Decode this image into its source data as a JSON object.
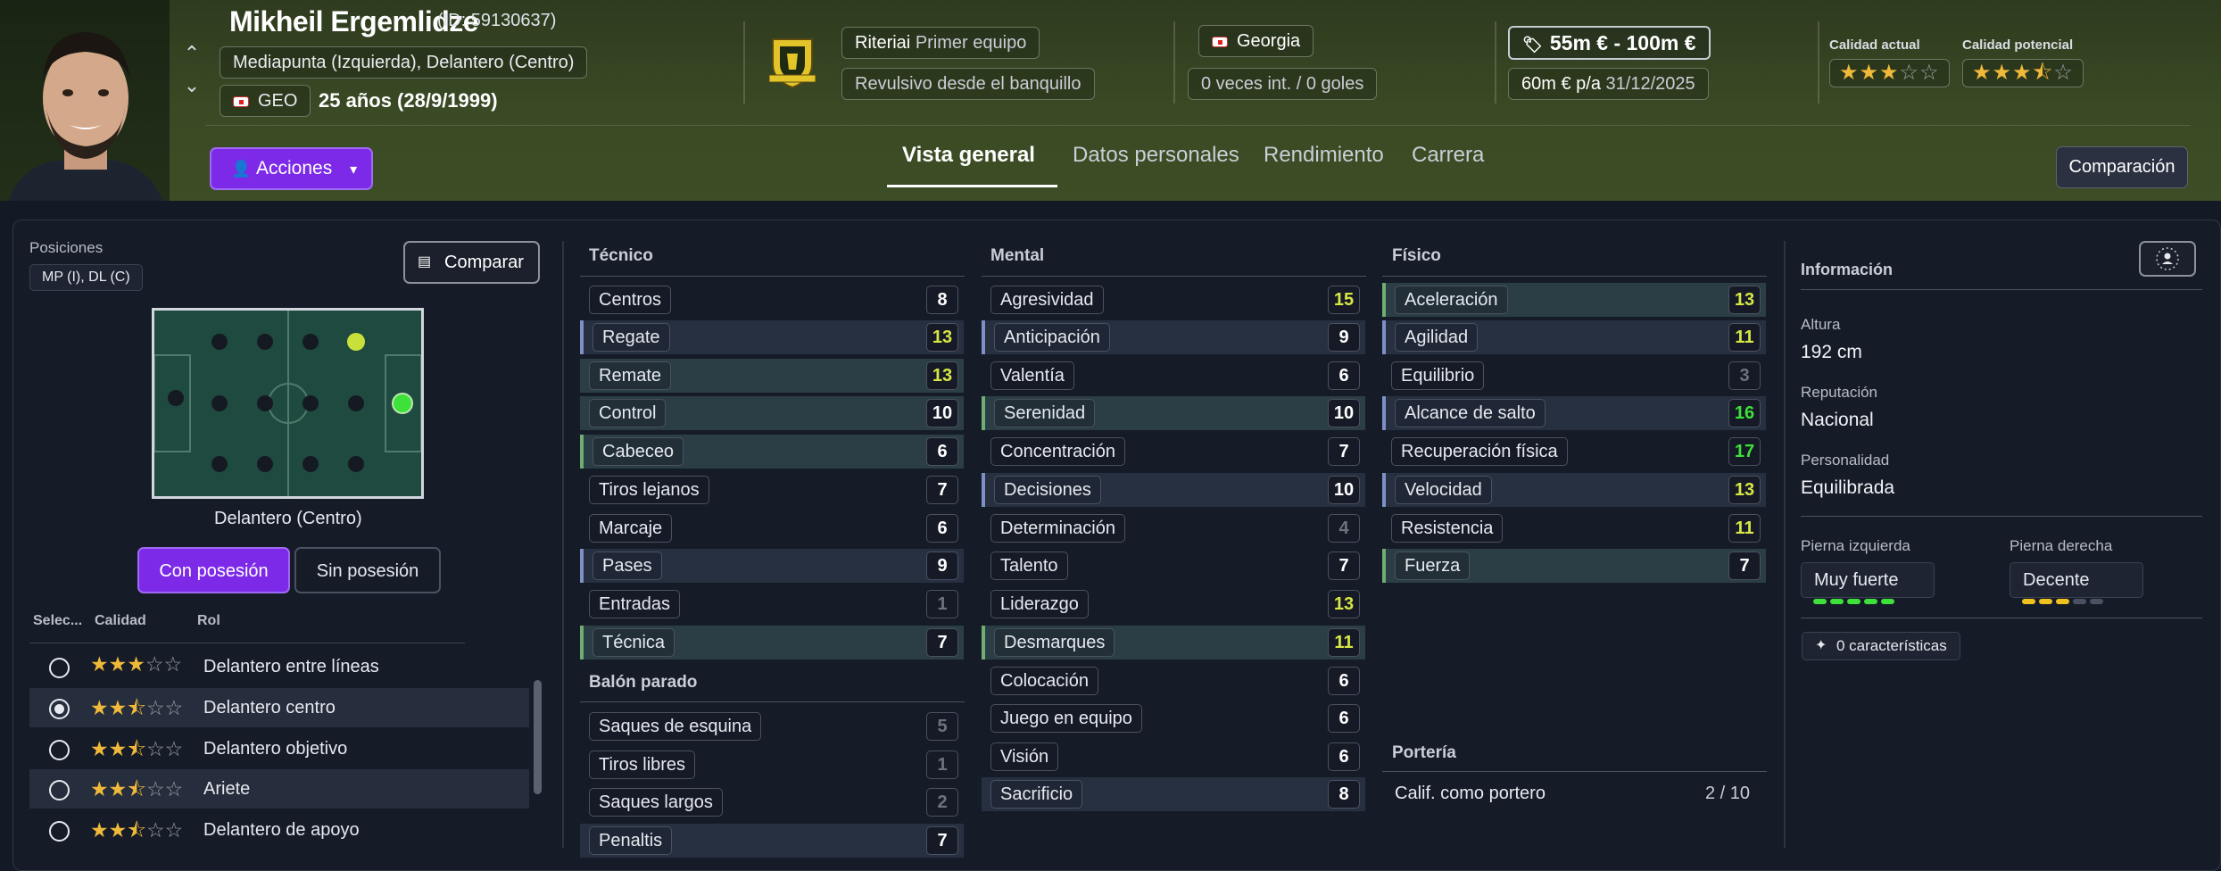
{
  "header": {
    "player_name": "Mikheil Ergemlidze",
    "player_id": "(ID: 59130637)",
    "positions_text": "Mediapunta (Izquierda), Delantero (Centro)",
    "nationality_code": "GEO",
    "age_text": "25 años (28/9/1999)",
    "club_label": "Riteriai",
    "club_squad": "Primer equipo",
    "squad_status": "Revulsivo desde el banquillo",
    "country": "Georgia",
    "international": "0 veces int. / 0 goles",
    "value_range": "55m € - 100m €",
    "wage": "60m € p/a",
    "contract_end": "31/12/2025",
    "current_ability_label": "Calidad actual",
    "potential_ability_label": "Calidad potencial",
    "current_ability_stars": 3,
    "potential_ability_stars": 3.5
  },
  "nav": {
    "actions_label": "Acciones",
    "tabs": [
      "Vista general",
      "Datos personales",
      "Rendimiento",
      "Carrera"
    ],
    "active_tab": "Vista general",
    "compare_label": "Comparación"
  },
  "left": {
    "positions_label": "Posiciones",
    "positions_value": "MP (I), DL (C)",
    "compare_btn": "Comparar",
    "pitch_position_name": "Delantero (Centro)",
    "with_possession": "Con posesión",
    "without_possession": "Sin posesión",
    "col_select": "Selec...",
    "col_quality": "Calidad",
    "col_role": "Rol",
    "roles": [
      {
        "name": "Delantero entre líneas",
        "stars": 3,
        "selected": false
      },
      {
        "name": "Delantero centro",
        "stars": 2.5,
        "selected": true
      },
      {
        "name": "Delantero objetivo",
        "stars": 2.5,
        "selected": false
      },
      {
        "name": "Ariete",
        "stars": 2.5,
        "selected": false
      },
      {
        "name": "Delantero de apoyo",
        "stars": 2.5,
        "selected": false
      }
    ]
  },
  "technical": {
    "title": "Técnico",
    "attrs": [
      {
        "name": "Centros",
        "value": "8"
      },
      {
        "name": "Regate",
        "value": "13"
      },
      {
        "name": "Remate",
        "value": "13"
      },
      {
        "name": "Control",
        "value": "10"
      },
      {
        "name": "Cabeceo",
        "value": "6"
      },
      {
        "name": "Tiros lejanos",
        "value": "7"
      },
      {
        "name": "Marcaje",
        "value": "6"
      },
      {
        "name": "Pases",
        "value": "9"
      },
      {
        "name": "Entradas",
        "value": "1"
      },
      {
        "name": "Técnica",
        "value": "7"
      }
    ]
  },
  "set_pieces": {
    "title": "Balón parado",
    "attrs": [
      {
        "name": "Saques de esquina",
        "value": "5"
      },
      {
        "name": "Tiros libres",
        "value": "1"
      },
      {
        "name": "Saques largos",
        "value": "2"
      },
      {
        "name": "Penaltis",
        "value": "7"
      }
    ]
  },
  "mental": {
    "title": "Mental",
    "attrs": [
      {
        "name": "Agresividad",
        "value": "15"
      },
      {
        "name": "Anticipación",
        "value": "9"
      },
      {
        "name": "Valentía",
        "value": "6"
      },
      {
        "name": "Serenidad",
        "value": "10"
      },
      {
        "name": "Concentración",
        "value": "7"
      },
      {
        "name": "Decisiones",
        "value": "10"
      },
      {
        "name": "Determinación",
        "value": "4"
      },
      {
        "name": "Talento",
        "value": "7"
      },
      {
        "name": "Liderazgo",
        "value": "13"
      },
      {
        "name": "Desmarques",
        "value": "11"
      },
      {
        "name": "Colocación",
        "value": "6"
      },
      {
        "name": "Juego en equipo",
        "value": "6"
      },
      {
        "name": "Visión",
        "value": "6"
      },
      {
        "name": "Sacrificio",
        "value": "8"
      }
    ]
  },
  "physical": {
    "title": "Físico",
    "attrs": [
      {
        "name": "Aceleración",
        "value": "13"
      },
      {
        "name": "Agilidad",
        "value": "11"
      },
      {
        "name": "Equilibrio",
        "value": "3"
      },
      {
        "name": "Alcance de salto",
        "value": "16"
      },
      {
        "name": "Recuperación física",
        "value": "17"
      },
      {
        "name": "Velocidad",
        "value": "13"
      },
      {
        "name": "Resistencia",
        "value": "11"
      },
      {
        "name": "Fuerza",
        "value": "7"
      }
    ]
  },
  "goalkeeping": {
    "title": "Portería",
    "label": "Calif. como portero",
    "value": "2 / 10"
  },
  "info": {
    "title": "Información",
    "height_label": "Altura",
    "height": "192 cm",
    "reputation_label": "Reputación",
    "reputation": "Nacional",
    "personality_label": "Personalidad",
    "personality": "Equilibrada",
    "left_foot_label": "Pierna izquierda",
    "left_foot": "Muy fuerte",
    "left_foot_level": 5,
    "right_foot_label": "Pierna derecha",
    "right_foot": "Decente",
    "right_foot_level": 3,
    "traits": "0 características"
  }
}
